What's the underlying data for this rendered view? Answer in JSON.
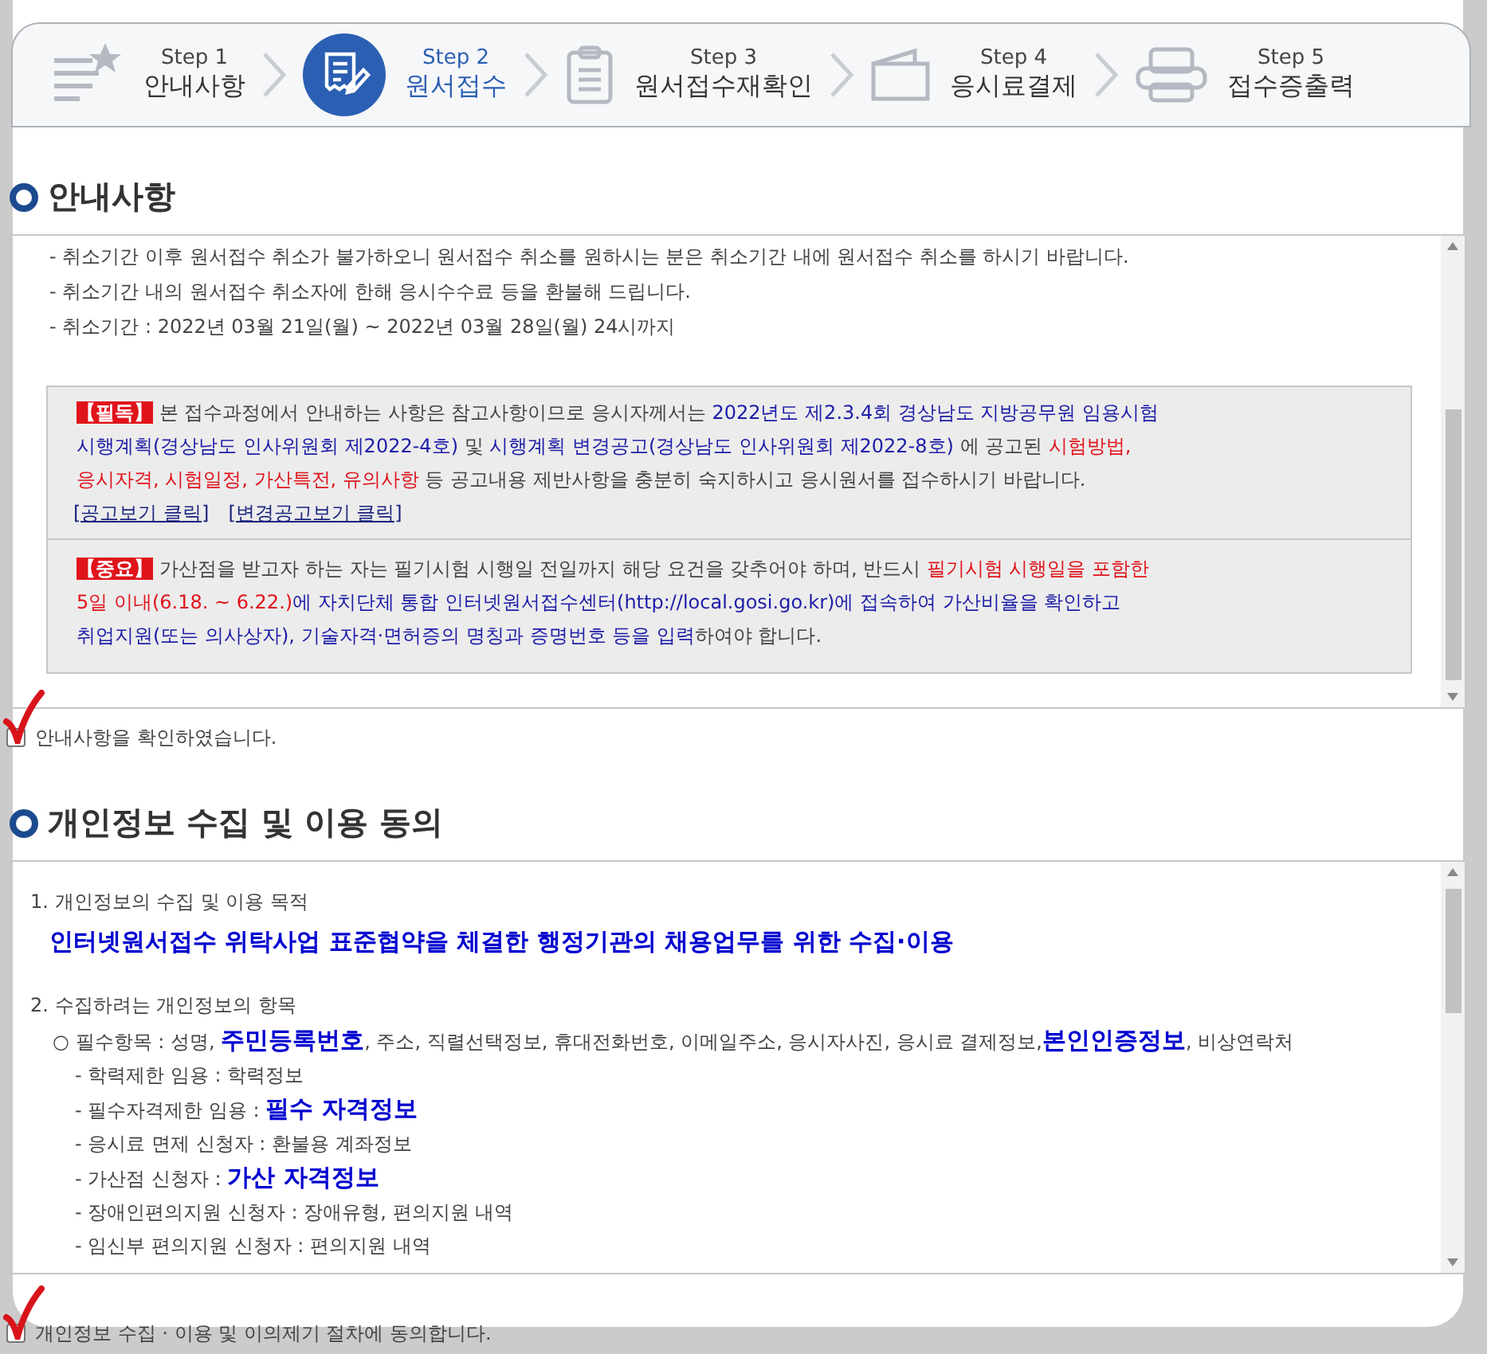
{
  "steps": [
    {
      "step": "Step 1",
      "label": "안내사항",
      "selected": false
    },
    {
      "step": "Step 2",
      "label": "원서접수",
      "selected": true
    },
    {
      "step": "Step 3",
      "label": "원서접수재확인",
      "selected": false
    },
    {
      "step": "Step 4",
      "label": "응시료결제",
      "selected": false
    },
    {
      "step": "Step 5",
      "label": "접수증출력",
      "selected": false
    }
  ],
  "notice_section": {
    "title": "안내사항",
    "lines": [
      "- 취소기간 이후 원서접수 취소가 불가하오니 원서접수 취소를 원하시는 분은 취소기간 내에 원서접수 취소를 하시기 바랍니다.",
      "- 취소기간 내의 원서접수 취소자에 한해 응시수수료 등을 환불해 드립니다.",
      "- 취소기간 : 2022년 03월 21일(월) ~ 2022년 03월 28일(월) 24시까지"
    ],
    "boxes": [
      {
        "lines": [
          [
            {
              "kind": "badge",
              "text": "【필독】"
            },
            {
              "kind": "plain",
              "text": " 본 접수과정에서 안내하는 사항은 참고사항이므로 응시자께서는 "
            },
            {
              "kind": "blue",
              "text": "2022년도 제2.3.4회 경상남도 지방공무원 임용시험"
            }
          ],
          [
            {
              "kind": "blue",
              "text": "시행계획(경상남도 인사위원회 제2022-4호)"
            },
            {
              "kind": "plain",
              "text": " 및 "
            },
            {
              "kind": "blue",
              "text": "시행계획 변경공고(경상남도 인사위원회 제2022-8호)"
            },
            {
              "kind": "plain",
              "text": " 에 공고된 "
            },
            {
              "kind": "red",
              "text": "시험방법,"
            }
          ],
          [
            {
              "kind": "red",
              "text": "응시자격, 시험일정, 가산특전, 유의사항"
            },
            {
              "kind": "plain",
              "text": " 등 공고내용 제반사항을 충분히 숙지하시고 응시원서를 접수하시기 바랍니다."
            }
          ]
        ],
        "links": [
          "[공고보기 클릭]",
          "[변경공고보기 클릭]"
        ]
      },
      {
        "lines": [
          [
            {
              "kind": "badge",
              "text": "【중요】"
            },
            {
              "kind": "plain",
              "text": " 가산점을 받고자 하는 자는 필기시험 시행일 전일까지 해당 요건을 갖추어야 하며, 반드시 "
            },
            {
              "kind": "red",
              "text": "필기시험 시행일을 포함한"
            }
          ],
          [
            {
              "kind": "red",
              "text": "5일 이내(6.18. ~ 6.22.)"
            },
            {
              "kind": "blue",
              "text": "에 자치단체 통합 인터넷원서접수센터(http://local.gosi.go.kr)에 접속하여 가산비율을 확인하고"
            }
          ],
          [
            {
              "kind": "blue",
              "text": "취업지원(또는 의사상자), 기술자격·면허증의 명칭과 증명번호 등을 입력"
            },
            {
              "kind": "plain",
              "text": "하여야 합니다."
            }
          ]
        ]
      }
    ],
    "agreement": {
      "label": "안내사항을 확인하였습니다.",
      "checked": true
    }
  },
  "privacy_section": {
    "title": "개인정보 수집 및 이용 동의",
    "items": [
      {
        "kind": "heading",
        "segments": [
          {
            "kind": "plain",
            "text": "1. 개인정보의 수집 및 이용 목적"
          }
        ]
      },
      {
        "kind": "purpose",
        "segments": [
          {
            "kind": "strong",
            "text": "인터넷원서접수 위탁사업 표준협약을 체결한 행정기관의 채용업무를 위한 수집·이용"
          }
        ]
      },
      {
        "kind": "heading",
        "segments": [
          {
            "kind": "plain",
            "text": "2. 수집하려는 개인정보의 항목"
          }
        ]
      },
      {
        "kind": "item",
        "segments": [
          {
            "kind": "plain",
            "text": "○ 필수항목 : 성명, "
          },
          {
            "kind": "strong",
            "text": "주민등록번호"
          },
          {
            "kind": "plain",
            "text": ", 주소, 직렬선택정보, 휴대전화번호, 이메일주소, 응시자사진, 응시료 결제정보,"
          },
          {
            "kind": "strong",
            "text": "본인인증정보"
          },
          {
            "kind": "plain",
            "text": ", 비상연락처"
          }
        ]
      },
      {
        "kind": "sub",
        "segments": [
          {
            "kind": "plain",
            "text": "- 학력제한 임용 : 학력정보"
          }
        ]
      },
      {
        "kind": "sub",
        "segments": [
          {
            "kind": "plain",
            "text": "- 필수자격제한 임용 : "
          },
          {
            "kind": "strong",
            "text": "필수 자격정보"
          }
        ]
      },
      {
        "kind": "sub",
        "segments": [
          {
            "kind": "plain",
            "text": "- 응시료 면제 신청자 : 환불용 계좌정보"
          }
        ]
      },
      {
        "kind": "sub",
        "segments": [
          {
            "kind": "plain",
            "text": "- 가산점 신청자 : "
          },
          {
            "kind": "strong",
            "text": "가산 자격정보"
          }
        ]
      },
      {
        "kind": "sub",
        "segments": [
          {
            "kind": "plain",
            "text": "- 장애인편의지원 신청자 : 장애유형, 편의지원 내역"
          }
        ]
      },
      {
        "kind": "sub",
        "segments": [
          {
            "kind": "plain",
            "text": "- 임신부 편의지원 신청자 : 편의지원 내역"
          }
        ]
      }
    ],
    "agreement": {
      "label": "개인정보 수집 · 이용 및 이의제기 절차에 동의합니다.",
      "checked": true
    }
  }
}
